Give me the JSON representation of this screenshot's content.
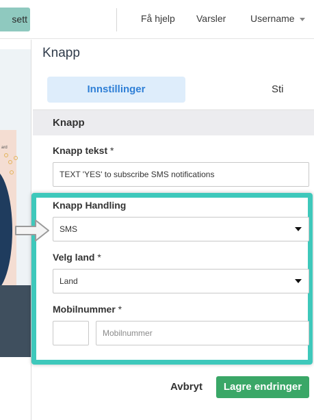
{
  "topbar": {
    "partial_button_label": "sett",
    "help": "Få hjelp",
    "notifications": "Varsler",
    "username": "Username"
  },
  "panel": {
    "title": "Knapp",
    "tabs": [
      {
        "label": "Innstillinger",
        "active": true
      },
      {
        "label": "Sti",
        "active": false
      }
    ],
    "section_title": "Knapp"
  },
  "form": {
    "button_text": {
      "label": "Knapp tekst",
      "required_mark": "*",
      "value": "TEXT 'YES' to subscribe SMS notifications"
    },
    "button_action": {
      "label": "Knapp Handling",
      "value": "SMS"
    },
    "country": {
      "label": "Velg land",
      "required_mark": "*",
      "value": "Land"
    },
    "mobile": {
      "label": "Mobilnummer",
      "required_mark": "*",
      "prefix_value": "",
      "placeholder": "Mobilnummer"
    }
  },
  "actions": {
    "cancel": "Avbryt",
    "save": "Lagre endringer"
  },
  "preview": {
    "partial_text": "ard"
  },
  "colors": {
    "highlight": "#3ec8bb",
    "save_button": "#3aa767",
    "tab_active_bg": "#deedfb",
    "tab_active_text": "#2f7fd6",
    "top_button": "#8fc9bf"
  },
  "icons": [
    "chevron-down-icon",
    "select-arrow-icon",
    "pointer-arrow-icon"
  ]
}
